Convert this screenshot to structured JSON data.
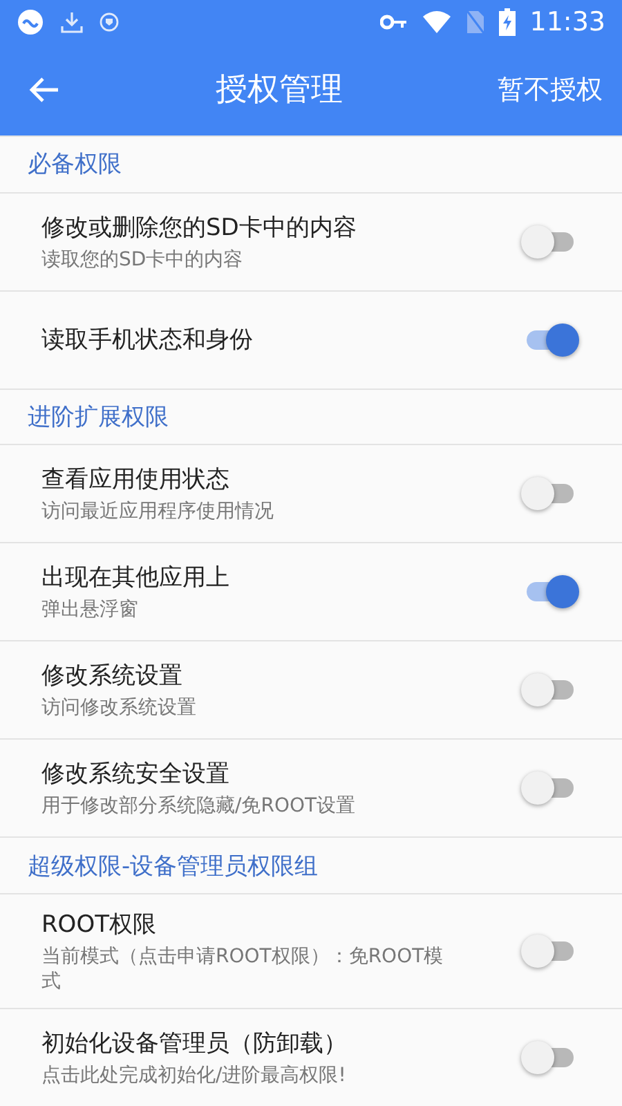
{
  "status_bar": {
    "time": "11:33"
  },
  "toolbar": {
    "title": "授权管理",
    "action": "暂不授权"
  },
  "sections": [
    {
      "title": "必备权限",
      "items": [
        {
          "title": "修改或删除您的SD卡中的内容",
          "subtitle": "读取您的SD卡中的内容",
          "on": false
        },
        {
          "title": "读取手机状态和身份",
          "on": true
        }
      ]
    },
    {
      "title": "进阶扩展权限",
      "items": [
        {
          "title": "查看应用使用状态",
          "subtitle": "访问最近应用程序使用情况",
          "on": false
        },
        {
          "title": "出现在其他应用上",
          "subtitle": "弹出悬浮窗",
          "on": true
        },
        {
          "title": "修改系统设置",
          "subtitle": "访问修改系统设置",
          "on": false
        },
        {
          "title": "修改系统安全设置",
          "subtitle": "用于修改部分系统隐藏/免ROOT设置",
          "on": false
        }
      ]
    },
    {
      "title": "超级权限-设备管理员权限组",
      "items": [
        {
          "title": "ROOT权限",
          "subtitle": "当前模式（点击申请ROOT权限）：免ROOT模式",
          "on": false
        },
        {
          "title": "初始化设备管理员（防卸载）",
          "subtitle": "点击此处完成初始化/进阶最高权限!",
          "on": false
        }
      ]
    }
  ]
}
